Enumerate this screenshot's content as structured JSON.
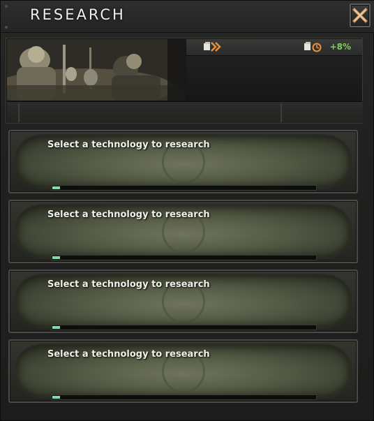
{
  "window": {
    "title": "Research"
  },
  "header": {
    "research_speed_icon": "research-speed-arrows-icon",
    "bonus_icon": "research-bonus-clock-icon",
    "research_bonus": "+8%"
  },
  "slots": [
    {
      "label": "Select a technology to research",
      "progress": 0.03
    },
    {
      "label": "Select a technology to research",
      "progress": 0.03
    },
    {
      "label": "Select a technology to research",
      "progress": 0.03
    },
    {
      "label": "Select a technology to research",
      "progress": 0.03
    }
  ],
  "colors": {
    "progress": "#7ee0a8",
    "bonus": "#7ed15a",
    "close": "#d4a06a"
  }
}
